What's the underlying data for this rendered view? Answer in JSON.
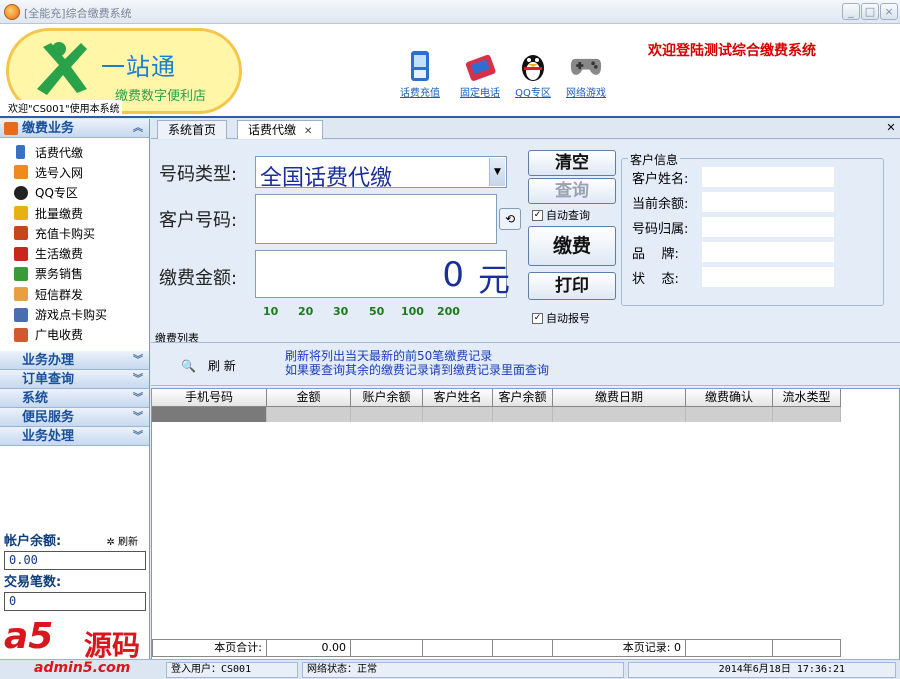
{
  "window": {
    "title": "[全能充]综合缴费系统",
    "controls": [
      "_",
      "□",
      "×"
    ]
  },
  "header": {
    "logo_main": "一站通",
    "logo_sub": "缴费数字便利店",
    "welcome_user": "欢迎\"CS001\"使用本系统",
    "welcome_banner": "欢迎登陆测试综合缴费系统",
    "toolbar": [
      {
        "label": "话费充值",
        "icon": "mobile-phone-icon"
      },
      {
        "label": "固定电话",
        "icon": "landline-phone-icon"
      },
      {
        "label": "QQ专区",
        "icon": "qq-penguin-icon"
      },
      {
        "label": "网络游戏",
        "icon": "gamepad-icon"
      }
    ]
  },
  "sidebar": {
    "main_section": "缴费业务",
    "items": [
      {
        "label": "话费代缴",
        "color": "#3b6fc2"
      },
      {
        "label": "选号入网",
        "color": "#f08a1c"
      },
      {
        "label": "QQ专区",
        "color": "#222222"
      },
      {
        "label": "批量缴费",
        "color": "#e8b010"
      },
      {
        "label": "充值卡购买",
        "color": "#c8461c"
      },
      {
        "label": "生活缴费",
        "color": "#c8281c"
      },
      {
        "label": "票务销售",
        "color": "#3a9a3a"
      },
      {
        "label": "短信群发",
        "color": "#e6a040"
      },
      {
        "label": "游戏点卡购买",
        "color": "#4a6fae"
      },
      {
        "label": "广电收费",
        "color": "#d05a30"
      }
    ],
    "sections": [
      "业务办理",
      "订单查询",
      "系统",
      "便民服务",
      "业务处理"
    ],
    "balance_label": "帐户余额:",
    "balance_value": "0.00",
    "refresh_label": "刷新",
    "tx_label": "交易笔数:",
    "tx_value": "0"
  },
  "tabs": [
    {
      "label": "系统首页"
    },
    {
      "label": "话费代缴"
    }
  ],
  "form": {
    "type_label": "号码类型:",
    "type_value": "全国话费代缴",
    "phone_label": "客户号码:",
    "amount_label": "缴费金额:",
    "amount_value": "0",
    "amount_unit": "元",
    "quick_amounts": [
      "10",
      "20",
      "30",
      "50",
      "100",
      "200"
    ],
    "btn_clear": "清空",
    "btn_query": "查询",
    "auto_query": "自动查询",
    "btn_pay": "缴费",
    "btn_print": "打印",
    "auto_report": "自动报号"
  },
  "customer": {
    "legend": "客户信息",
    "fields": [
      "客户姓名:",
      "当前余额:",
      "号码归属:",
      "品    牌:",
      "状    态:"
    ]
  },
  "list": {
    "title": "缴费列表",
    "refresh": "刷 新",
    "hint_line1": "刷新将列出当天最新的前50笔缴费记录",
    "hint_line2": "如果要查询其余的缴费记录请到缴费记录里面查询",
    "columns": [
      "手机号码",
      "金额",
      "账户余额",
      "客户姓名",
      "客户余额",
      "缴费日期",
      "缴费确认",
      "流水类型"
    ],
    "footer_total_label": "本页合计:",
    "footer_total_value": "0.00",
    "footer_records": "本页记录: 0"
  },
  "statusbar": {
    "user": "登入用户：CS001",
    "network": "网络状态：正常",
    "datetime": "2014年6月18日  17:36:21"
  },
  "watermark": {
    "brand": "a5",
    "cn": "源码",
    "domain": "admin5.com"
  }
}
